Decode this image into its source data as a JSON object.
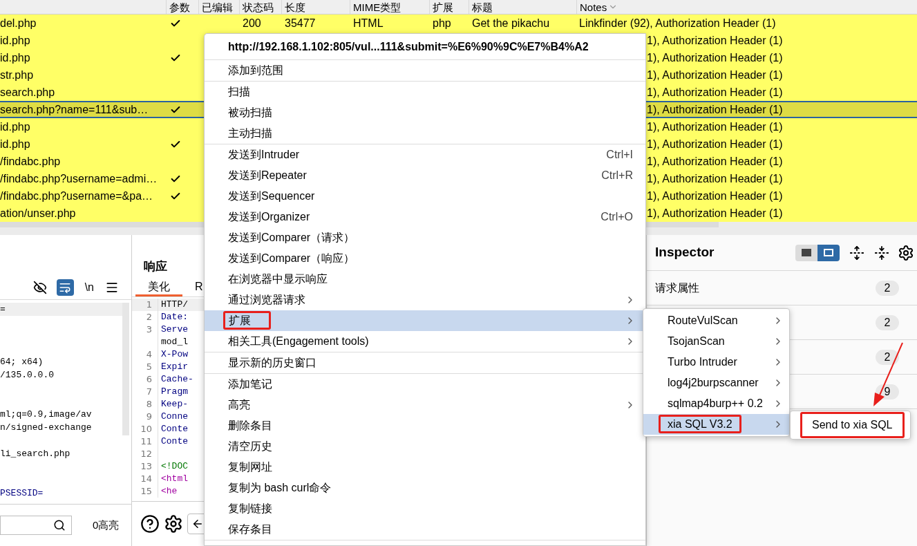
{
  "table": {
    "columns": [
      {
        "label": "参数"
      },
      {
        "label": "已编辑"
      },
      {
        "label": "状态码"
      },
      {
        "label": "长度"
      },
      {
        "label": "MIME类型"
      },
      {
        "label": "扩展"
      },
      {
        "label": "标题"
      },
      {
        "label": "Notes",
        "sorted": true
      }
    ],
    "rows": [
      {
        "url": "del.php",
        "params": true,
        "selected": false,
        "cells": [
          "200",
          "35477",
          "HTML",
          "php",
          "Get the pikachu"
        ],
        "notes": "Linkfinder (92), Authorization Header (1)"
      },
      {
        "url": "id.php",
        "params": false,
        "selected": false,
        "notes": "1), Authorization Header (1)"
      },
      {
        "url": "id.php",
        "params": true,
        "selected": false,
        "notes": "1), Authorization Header (1)"
      },
      {
        "url": "str.php",
        "params": false,
        "selected": false,
        "notes": "1), Authorization Header (1)"
      },
      {
        "url": "search.php",
        "params": false,
        "selected": false,
        "notes": "1), Authorization Header (1)"
      },
      {
        "url": "search.php?name=111&sub…",
        "params": true,
        "selected": true,
        "notes": "1), Authorization Header (1)"
      },
      {
        "url": "id.php",
        "params": false,
        "selected": false,
        "notes": "1), Authorization Header (1)"
      },
      {
        "url": "id.php",
        "params": true,
        "selected": false,
        "notes": "1), Authorization Header (1)"
      },
      {
        "url": "/findabc.php",
        "params": false,
        "selected": false,
        "notes": "1), Authorization Header (1)"
      },
      {
        "url": "/findabc.php?username=admi…",
        "params": true,
        "selected": false,
        "notes": "1), Authorization Header (1)"
      },
      {
        "url": "/findabc.php?username=&pa…",
        "params": true,
        "selected": false,
        "notes": "1), Authorization Header (1)"
      },
      {
        "url": "ation/unser.php",
        "params": false,
        "selected": false,
        "notes": "1), Authorization Header (1)"
      }
    ]
  },
  "request": {
    "hide_on": false,
    "wrap_on": true,
    "newline_label": "\\n",
    "lines": [
      {
        "text": "=",
        "highlighted": true,
        "kind": "plain"
      },
      {
        "kind": "blank",
        "highlighted": false
      },
      {
        "kind": "blank",
        "highlighted": false
      },
      {
        "kind": "blank",
        "highlighted": false
      },
      {
        "text": "64; x64)",
        "highlighted": false,
        "kind": "plain"
      },
      {
        "text": "/135.0.0.0",
        "highlighted": false,
        "kind": "plain"
      },
      {
        "kind": "blank",
        "highlighted": false
      },
      {
        "kind": "blank",
        "highlighted": false
      },
      {
        "text": "ml;q=0.9,image/av",
        "highlighted": false,
        "kind": "plain"
      },
      {
        "text": "n/signed-exchange",
        "highlighted": false,
        "kind": "plain"
      },
      {
        "kind": "blank",
        "highlighted": false
      },
      {
        "text": "li_search.php",
        "highlighted": false,
        "kind": "plain"
      },
      {
        "kind": "blank",
        "highlighted": false
      },
      {
        "kind": "blank",
        "highlighted": false
      },
      {
        "text": "PSESSID=",
        "highlighted": false,
        "kind": "header"
      }
    ],
    "highlight_count": "0高亮"
  },
  "response": {
    "title": "响应",
    "tabs": [
      {
        "label": "美化",
        "selected": true
      },
      {
        "label": "R",
        "selected": false
      }
    ],
    "lines": [
      {
        "number": "1",
        "text": "HTTP/",
        "kind": "plain",
        "highlighted": true
      },
      {
        "number": "2",
        "text": "Date:",
        "kind": "header",
        "highlighted": false
      },
      {
        "number": "3",
        "text": "Serve",
        "kind": "header",
        "highlighted": false
      },
      {
        "text": "mod_l",
        "kind": "plain",
        "highlighted": false
      },
      {
        "number": "4",
        "text": "X-Pow",
        "kind": "header",
        "highlighted": false
      },
      {
        "number": "5",
        "text": "Expir",
        "kind": "header",
        "highlighted": false
      },
      {
        "number": "6",
        "text": "Cache-",
        "kind": "header",
        "highlighted": false
      },
      {
        "number": "7",
        "text": "Pragm",
        "kind": "header",
        "highlighted": false
      },
      {
        "number": "8",
        "text": "Keep-",
        "kind": "header",
        "highlighted": false
      },
      {
        "number": "9",
        "text": "Conne",
        "kind": "header",
        "highlighted": false
      },
      {
        "number": "10",
        "text": "Conte",
        "kind": "header",
        "highlighted": false
      },
      {
        "number": "11",
        "text": "Conte",
        "kind": "header",
        "highlighted": false
      },
      {
        "number": "12",
        "highlighted": false
      },
      {
        "number": "13",
        "text": "<!DOC",
        "kind": "doctype",
        "highlighted": false
      },
      {
        "number": "14",
        "text": "<html",
        "kind": "tag",
        "highlighted": false
      },
      {
        "number": "15",
        "text": "<he",
        "kind": "tag",
        "highlighted": false
      }
    ]
  },
  "inspector": {
    "title": "Inspector",
    "layout_buttons": [
      {
        "selected": false
      },
      {
        "selected": true
      }
    ],
    "rows": [
      {
        "label": "请求属性",
        "count": "2"
      },
      {
        "count": "2"
      },
      {
        "count": "2"
      },
      {
        "count": "9"
      }
    ]
  },
  "context_menu": {
    "header": "http://192.168.1.102:805/vul...111&submit=%E6%90%9C%E7%B4%A2",
    "sections": [
      [
        {
          "label": "添加到范围",
          "selected": false,
          "boxed": false,
          "submenu": false
        }
      ],
      [
        {
          "label": "扫描",
          "selected": false,
          "boxed": false,
          "submenu": false
        },
        {
          "label": "被动扫描",
          "selected": false,
          "boxed": false,
          "submenu": false
        },
        {
          "label": "主动扫描",
          "selected": false,
          "boxed": false,
          "submenu": false
        }
      ],
      [
        {
          "label": "发送到Intruder",
          "shortcut": "Ctrl+I",
          "selected": false,
          "boxed": false,
          "submenu": false
        },
        {
          "label": "发送到Repeater",
          "shortcut": "Ctrl+R",
          "selected": false,
          "boxed": false,
          "submenu": false
        },
        {
          "label": "发送到Sequencer",
          "selected": false,
          "boxed": false,
          "submenu": false
        },
        {
          "label": "发送到Organizer",
          "shortcut": "Ctrl+O",
          "selected": false,
          "boxed": false,
          "submenu": false
        },
        {
          "label": "发送到Comparer（请求）",
          "selected": false,
          "boxed": false,
          "submenu": false
        },
        {
          "label": "发送到Comparer（响应）",
          "selected": false,
          "boxed": false,
          "submenu": false
        },
        {
          "label": "在浏览器中显示响应",
          "selected": false,
          "boxed": false,
          "submenu": false
        },
        {
          "label": "通过浏览器请求",
          "selected": false,
          "boxed": false,
          "submenu": true
        },
        {
          "label": "扩展",
          "selected": true,
          "boxed": true,
          "submenu": true
        },
        {
          "label": "相关工具(Engagement tools)",
          "selected": false,
          "boxed": false,
          "submenu": true
        }
      ],
      [
        {
          "label": "显示新的历史窗口",
          "selected": false,
          "boxed": false,
          "submenu": false
        }
      ],
      [
        {
          "label": "添加笔记",
          "selected": false,
          "boxed": false,
          "submenu": false
        },
        {
          "label": "高亮",
          "selected": false,
          "boxed": false,
          "submenu": true
        },
        {
          "label": "删除条目",
          "selected": false,
          "boxed": false,
          "submenu": false
        },
        {
          "label": "清空历史",
          "selected": false,
          "boxed": false,
          "submenu": false
        },
        {
          "label": "复制网址",
          "selected": false,
          "boxed": false,
          "submenu": false
        },
        {
          "label": "复制为 bash curl命令",
          "selected": false,
          "boxed": false,
          "submenu": false
        },
        {
          "label": "复制链接",
          "selected": false,
          "boxed": false,
          "submenu": false
        },
        {
          "label": "保存条目",
          "selected": false,
          "boxed": false,
          "submenu": false
        }
      ]
    ]
  },
  "extensions_menu": {
    "items": [
      {
        "label": "RouteVulScan",
        "selected": false,
        "boxed": false
      },
      {
        "label": "TsojanScan",
        "selected": false,
        "boxed": false
      },
      {
        "label": "Turbo Intruder",
        "selected": false,
        "boxed": false
      },
      {
        "label": "log4j2burpscanner",
        "selected": false,
        "boxed": false
      },
      {
        "label": "sqlmap4burp++ 0.2",
        "selected": false,
        "boxed": false
      },
      {
        "label": "xia SQL V3.2",
        "selected": true,
        "boxed": true
      }
    ]
  },
  "xia_sql_menu": {
    "items": [
      {
        "label": "Send to xia SQL",
        "selected": false,
        "boxed": true
      }
    ]
  }
}
